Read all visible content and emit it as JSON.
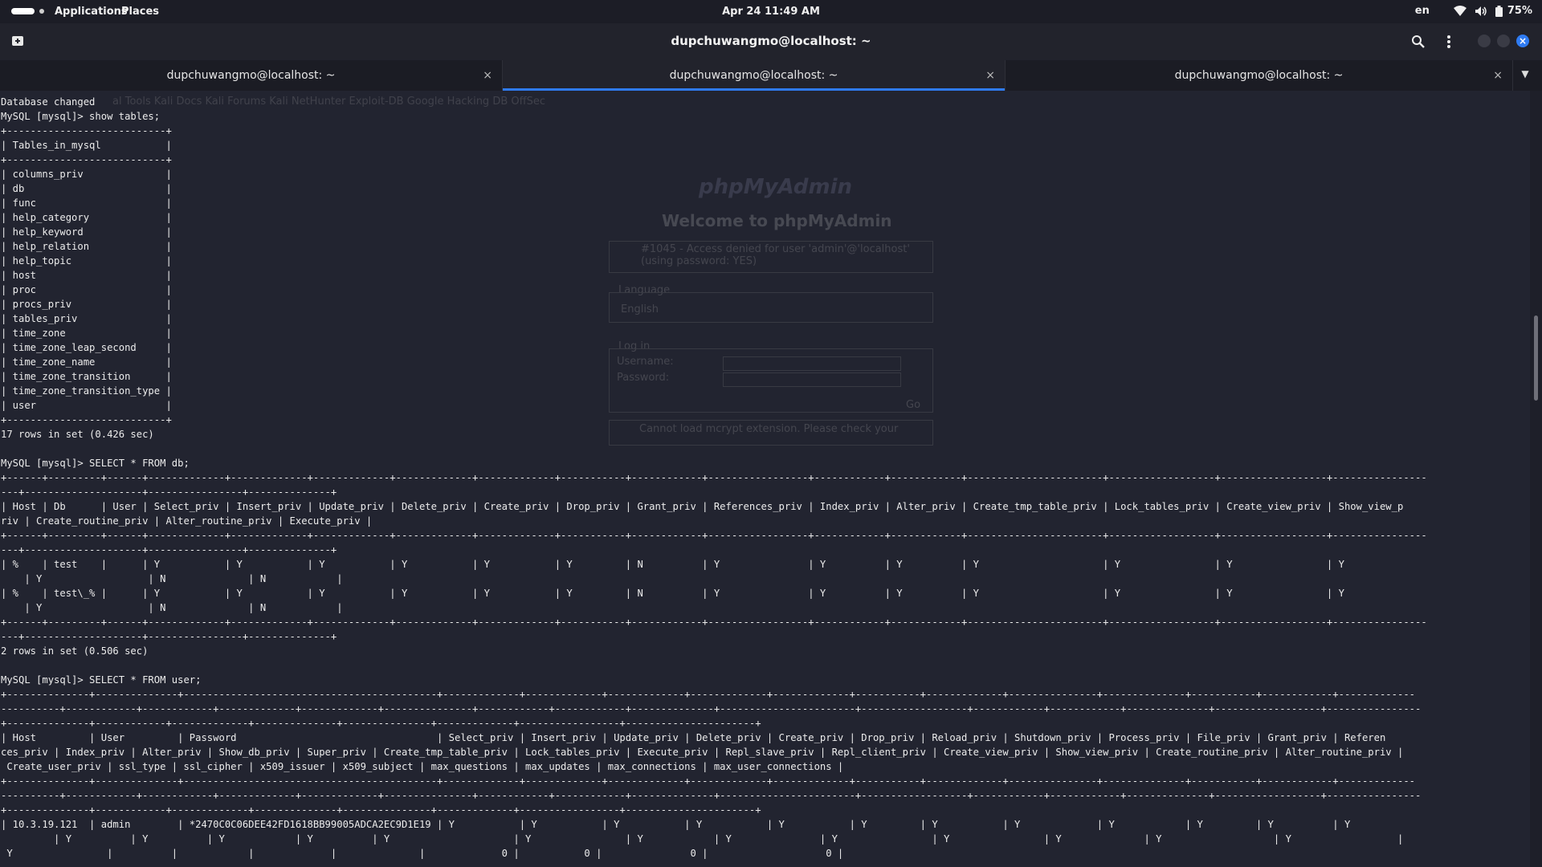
{
  "topbar": {
    "applications": "Applications",
    "places": "Places",
    "clock": "Apr 24  11:49 AM",
    "lang": "en",
    "battery": "75%"
  },
  "headerbar": {
    "title": "dupchuwangmo@localhost: ~"
  },
  "tabs": [
    {
      "label": "dupchuwangmo@localhost: ~",
      "close": "×"
    },
    {
      "label": "dupchuwangmo@localhost: ~",
      "close": "×"
    },
    {
      "label": "dupchuwangmo@localhost: ~",
      "close": "×"
    }
  ],
  "ghost": {
    "bookmarks": "al Tools   Kali Docs   Kali Forums   Kali NetHunter   Exploit-DB   Google Hacking DB   OffSec",
    "logo": "phpMyAdmin",
    "welcome": "Welcome to phpMyAdmin",
    "error": "#1045 - Access denied for user 'admin'@'localhost' (using password: YES)",
    "language_label": "Language",
    "language_value": "English",
    "login_label": "Log in",
    "username_label": "Username:",
    "password_label": "Password:",
    "go": "Go",
    "mcrypt": "Cannot load mcrypt extension. Please check your"
  },
  "terminal": {
    "lines": "Database changed\nMySQL [mysql]> show tables;\n+---------------------------+\n| Tables_in_mysql           |\n+---------------------------+\n| columns_priv              |\n| db                        |\n| func                      |\n| help_category             |\n| help_keyword              |\n| help_relation             |\n| help_topic                |\n| host                      |\n| proc                      |\n| procs_priv                |\n| tables_priv               |\n| time_zone                 |\n| time_zone_leap_second     |\n| time_zone_name            |\n| time_zone_transition      |\n| time_zone_transition_type |\n| user                      |\n+---------------------------+\n17 rows in set (0.426 sec)\n\nMySQL [mysql]> SELECT * FROM db;\n+------+---------+------+-------------+-------------+-------------+-------------+-------------+-----------+------------+-----------------+------------+------------+-----------------------+------------------+------------------+----------------\n---+--------------------+----------------+--------------+\n| Host | Db      | User | Select_priv | Insert_priv | Update_priv | Delete_priv | Create_priv | Drop_priv | Grant_priv | References_priv | Index_priv | Alter_priv | Create_tmp_table_priv | Lock_tables_priv | Create_view_priv | Show_view_p\nriv | Create_routine_priv | Alter_routine_priv | Execute_priv |\n+------+---------+------+-------------+-------------+-------------+-------------+-------------+-----------+------------+-----------------+------------+------------+-----------------------+------------------+------------------+----------------\n---+--------------------+----------------+--------------+\n| %    | test    |      | Y           | Y           | Y           | Y           | Y           | Y         | N          | Y               | Y          | Y          | Y                     | Y                | Y                | Y\n    | Y                  | N              | N            |\n| %    | test\\_% |      | Y           | Y           | Y           | Y           | Y           | Y         | N          | Y               | Y          | Y          | Y                     | Y                | Y                | Y\n    | Y                  | N              | N            |\n+------+---------+------+-------------+-------------+-------------+-------------+-------------+-----------+------------+-----------------+------------+------------+-----------------------+------------------+------------------+----------------\n---+--------------------+----------------+--------------+\n2 rows in set (0.506 sec)\n\nMySQL [mysql]> SELECT * FROM user;\n+--------------+--------------+-------------------------------------------+-------------+-------------+-------------+-------------+-------------+-----------+-------------+---------------+--------------+-----------+------------+-------------\n----------+------------+------------+-------------+-------------+---------------+------------+------------+--------------+-----------------------+------------------+------------+------------+--------------+------------------+----------------\n+--------------+------------+-------------+--------------+---------------+-------------+-----------------+----------------------+\n| Host         | User         | Password                                  | Select_priv | Insert_priv | Update_priv | Delete_priv | Create_priv | Drop_priv | Reload_priv | Shutdown_priv | Process_priv | File_priv | Grant_priv | Referen\nces_priv | Index_priv | Alter_priv | Show_db_priv | Super_priv | Create_tmp_table_priv | Lock_tables_priv | Execute_priv | Repl_slave_priv | Repl_client_priv | Create_view_priv | Show_view_priv | Create_routine_priv | Alter_routine_priv |\n Create_user_priv | ssl_type | ssl_cipher | x509_issuer | x509_subject | max_questions | max_updates | max_connections | max_user_connections |\n+--------------+--------------+-------------------------------------------+-------------+-------------+-------------+-------------+-------------+-----------+-------------+---------------+--------------+-----------+------------+-------------\n----------+------------+------------+-------------+-------------+---------------+------------+------------+--------------+-----------------------+------------------+------------+------------+--------------+------------------+----------------\n+--------------+------------+-------------+--------------+---------------+-------------+-----------------+----------------------+\n| 10.3.19.121  | admin        | *2470C0C06DEE42FD1618BB99005ADCA2EC9D1E19 | Y           | Y           | Y           | Y           | Y           | Y         | Y           | Y             | Y            | Y         | Y          | Y\n         | Y          | Y          | Y            | Y          | Y                     | Y                | Y            | Y               | Y                | Y                | Y              | Y                   | Y                  |\n Y                |          |            |             |              |             0 |           0 |               0 |                    0 |"
  }
}
